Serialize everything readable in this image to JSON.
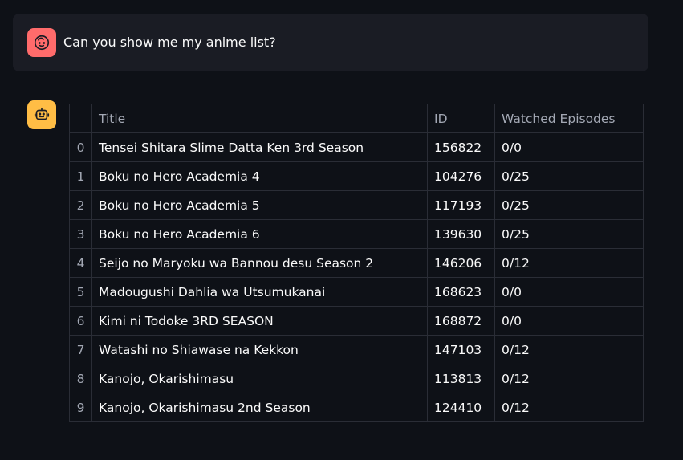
{
  "user_message": {
    "text": "Can you show me my anime list?",
    "avatar_icon": "user-face-icon",
    "avatar_color": "#ff6b6b"
  },
  "assistant": {
    "avatar_icon": "robot-icon",
    "avatar_color": "#ffbd45"
  },
  "table": {
    "columns": [
      "",
      "Title",
      "ID",
      "Watched Episodes"
    ],
    "rows": [
      {
        "index": "0",
        "title": "Tensei Shitara Slime Datta Ken 3rd Season",
        "id": "156822",
        "watched": "0/0"
      },
      {
        "index": "1",
        "title": "Boku no Hero Academia 4",
        "id": "104276",
        "watched": "0/25"
      },
      {
        "index": "2",
        "title": "Boku no Hero Academia 5",
        "id": "117193",
        "watched": "0/25"
      },
      {
        "index": "3",
        "title": "Boku no Hero Academia 6",
        "id": "139630",
        "watched": "0/25"
      },
      {
        "index": "4",
        "title": "Seijo no Maryoku wa Bannou desu Season 2",
        "id": "146206",
        "watched": "0/12"
      },
      {
        "index": "5",
        "title": "Madougushi Dahlia wa Utsumukanai",
        "id": "168623",
        "watched": "0/0"
      },
      {
        "index": "6",
        "title": "Kimi ni Todoke 3RD SEASON",
        "id": "168872",
        "watched": "0/0"
      },
      {
        "index": "7",
        "title": "Watashi no Shiawase na Kekkon",
        "id": "147103",
        "watched": "0/12"
      },
      {
        "index": "8",
        "title": "Kanojo, Okarishimasu",
        "id": "113813",
        "watched": "0/12"
      },
      {
        "index": "9",
        "title": "Kanojo, Okarishimasu 2nd Season",
        "id": "124410",
        "watched": "0/12"
      }
    ]
  }
}
